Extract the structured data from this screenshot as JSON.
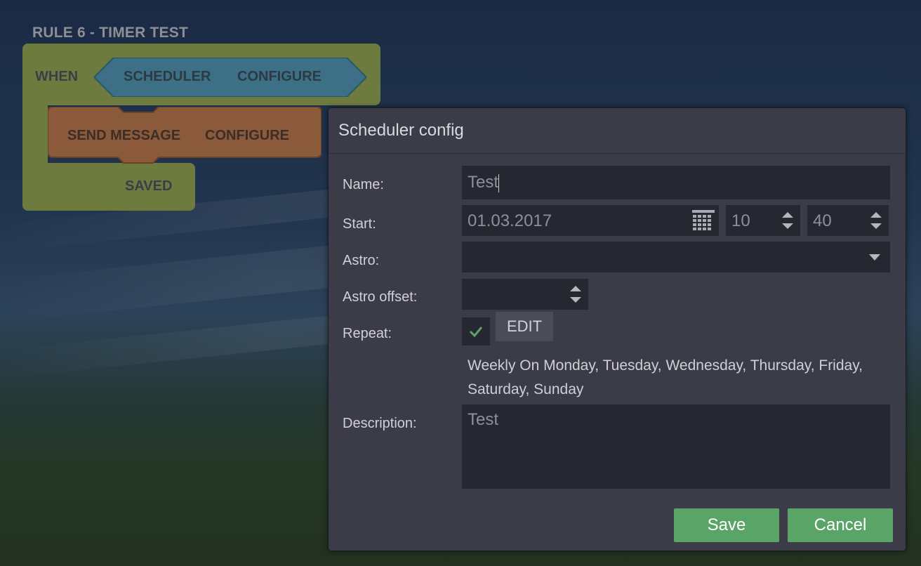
{
  "rule": {
    "title": "RULE 6 - TIMER TEST",
    "when_label": "WHEN",
    "trigger": {
      "name": "SCHEDULER",
      "configure_label": "CONFIGURE"
    },
    "action": {
      "name": "SEND MESSAGE",
      "configure_label": "CONFIGURE"
    },
    "status": "SAVED"
  },
  "dialog": {
    "title": "Scheduler config",
    "fields": {
      "name": {
        "label": "Name:",
        "value": "Test"
      },
      "start": {
        "label": "Start:",
        "date": "01.03.2017",
        "hour": "10",
        "minute": "40"
      },
      "astro": {
        "label": "Astro:",
        "value": ""
      },
      "astro_offset": {
        "label": "Astro offset:",
        "value": ""
      },
      "repeat": {
        "label": "Repeat:",
        "checked": true,
        "edit_label": "EDIT",
        "description": "Weekly On Monday, Tuesday, Wednesday, Thursday, Friday, Saturday, Sunday"
      },
      "description": {
        "label": "Description:",
        "value": "Test"
      }
    },
    "buttons": {
      "save": "Save",
      "cancel": "Cancel"
    }
  },
  "colors": {
    "accent_green": "#5aa467",
    "trigger_block": "#3d6f86",
    "action_block": "#8a5a3a",
    "rule_block": "#6e7b3f",
    "dialog_bg": "#3b3c48",
    "field_bg": "#262730"
  },
  "icons": {
    "calendar": "calendar-icon",
    "spinner": "spinner-arrows-icon",
    "dropdown": "chevron-down-icon",
    "check": "checkmark-icon"
  }
}
